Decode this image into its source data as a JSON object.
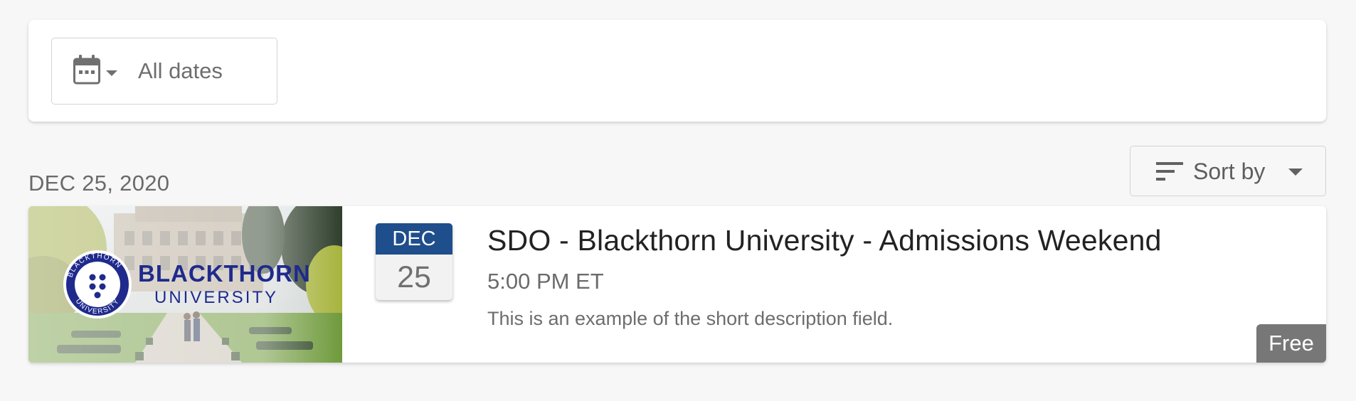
{
  "filters": {
    "date_filter": {
      "icon": "calendar-icon",
      "caret_icon": "caret-down-icon",
      "label": "All dates"
    }
  },
  "sort": {
    "icon": "sort-lines-icon",
    "label": "Sort by",
    "caret_icon": "caret-down-icon"
  },
  "group": {
    "date_heading": "DEC 25, 2020"
  },
  "event": {
    "image": {
      "semantic": "blackthorn-university-banner",
      "brand_line1": "BLACKTHORN",
      "brand_line2": "UNIVERSITY",
      "seal_text": "BLACKTHORN UNIVERSITY"
    },
    "date_badge": {
      "month": "DEC",
      "day": "25",
      "month_color": "#1f4e8c"
    },
    "title": "SDO - Blackthorn University - Admissions Weekend",
    "time": "5:00 PM ET",
    "description": "This is an example of the short description field.",
    "price": "Free"
  },
  "colors": {
    "brand_navy": "#1f2a8c",
    "badge_blue": "#1f4e8c",
    "price_tag_bg": "#777777"
  }
}
